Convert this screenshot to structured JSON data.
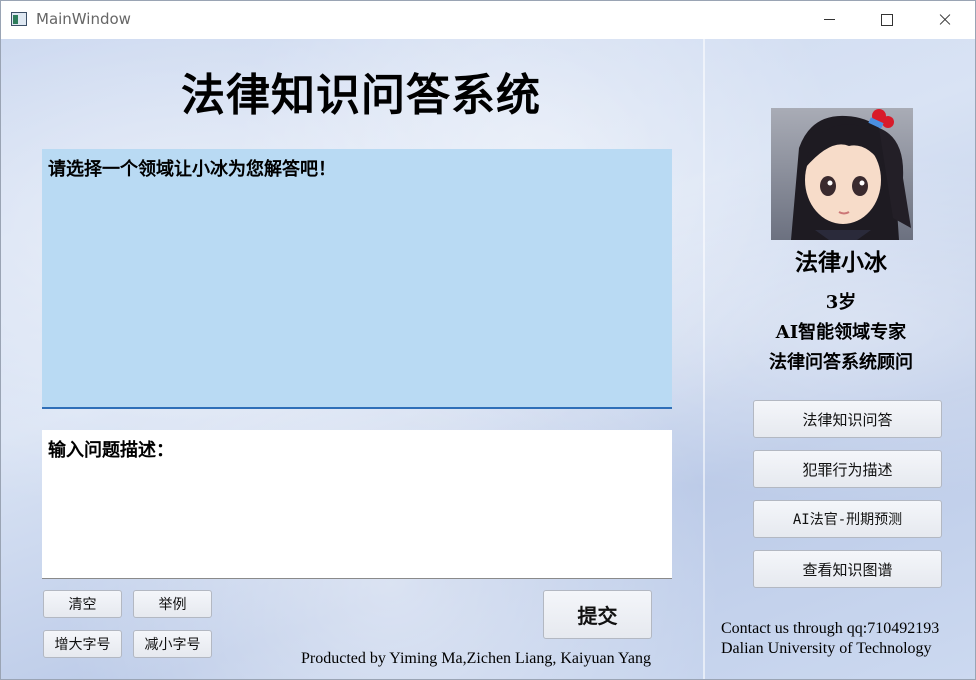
{
  "window": {
    "title": "MainWindow"
  },
  "main": {
    "title": "法律知识问答系统",
    "answer_text": "请选择一个领域让小冰为您解答吧！",
    "question_label": "输入问题描述：",
    "buttons": {
      "clear": "清空",
      "example": "举例",
      "font_bigger": "增大字号",
      "font_smaller": "减小字号",
      "submit": "提交"
    },
    "credits": "Producted by Yiming Ma,Zichen Liang, Kaiyuan Yang"
  },
  "sidebar": {
    "name": "法律小冰",
    "age": "3岁",
    "role": "AI智能领域专家",
    "position": "法律问答系统顾问",
    "buttons": [
      {
        "label": "法律知识问答"
      },
      {
        "label": "犯罪行为描述"
      },
      {
        "label": "AI法官-刑期预测"
      },
      {
        "label": "查看知识图谱"
      }
    ],
    "contact_line1": "Contact us through qq:710492193",
    "contact_line2": "Dalian University of Technology"
  }
}
